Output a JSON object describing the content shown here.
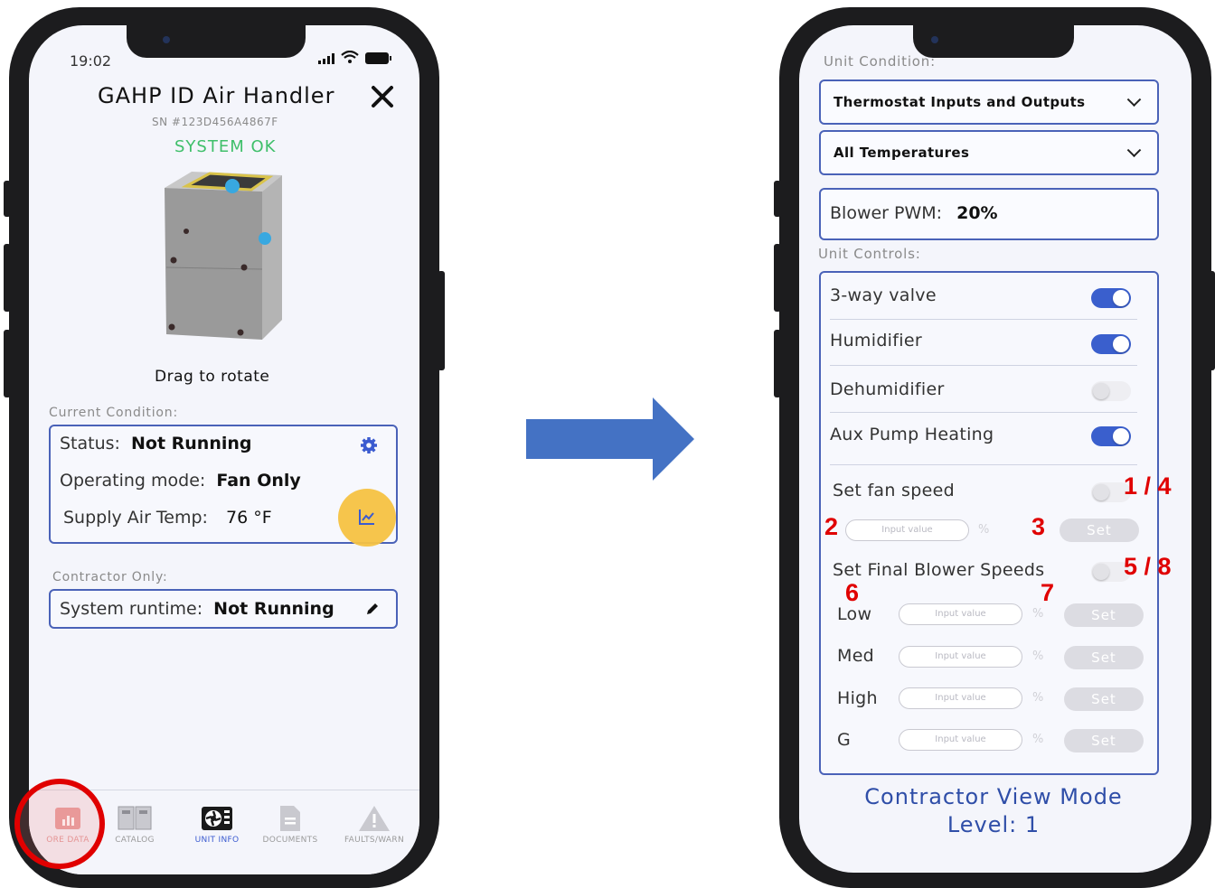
{
  "left_phone": {
    "status_time": "19:02",
    "title": "GAHP ID Air Handler",
    "serial": "SN #123D456A4867F",
    "system_status": "SYSTEM OK",
    "drag_caption": "Drag to rotate",
    "current_condition_label": "Current Condition:",
    "status_label": "Status:",
    "status_value": "Not Running",
    "mode_label": "Operating mode:",
    "mode_value": "Fan Only",
    "supply_label": "Supply Air Temp:",
    "supply_value": "76 °F",
    "contractor_label": "Contractor Only:",
    "runtime_label": "System runtime:",
    "runtime_value": "Not Running",
    "tabs": [
      {
        "label": "ORE DATA",
        "icon": "bar-chart-icon"
      },
      {
        "label": "CATALOG",
        "icon": "book-icon"
      },
      {
        "label": "UNIT INFO",
        "icon": "fan-unit-icon"
      },
      {
        "label": "DOCUMENTS",
        "icon": "document-icon"
      },
      {
        "label": "FAULTS/WARN",
        "icon": "warning-icon"
      }
    ]
  },
  "right_phone": {
    "unit_condition_label": "Unit Condition:",
    "select_1": "Thermostat Inputs and Outputs",
    "select_2": "All Temperatures",
    "blower_label": "Blower PWM:",
    "blower_value": "20%",
    "unit_controls_label": "Unit Controls:",
    "toggles": [
      {
        "label": "3-way valve",
        "on": true
      },
      {
        "label": "Humidifier",
        "on": true
      },
      {
        "label": "Dehumidifier",
        "on": false
      },
      {
        "label": "Aux Pump Heating",
        "on": true
      }
    ],
    "fan_speed_label": "Set fan speed",
    "input_placeholder": "Input value",
    "percent": "%",
    "set_label": "Set",
    "final_speeds_label": "Set Final Blower Speeds",
    "speed_rows": [
      "Low",
      "Med",
      "High",
      "G"
    ],
    "footer_line1": "Contractor View Mode",
    "footer_line2": "Level: 1"
  },
  "annotations": {
    "a1": "1 / 4",
    "a2": "2",
    "a3": "3",
    "a4": "5 / 8",
    "a5": "6",
    "a6": "7"
  },
  "colors": {
    "accent": "#4a62b8",
    "ok_green": "#3fbf6a",
    "arrow_blue": "#4472c4",
    "annotation_red": "#e00000",
    "highlight_yellow": "#f5c242"
  }
}
